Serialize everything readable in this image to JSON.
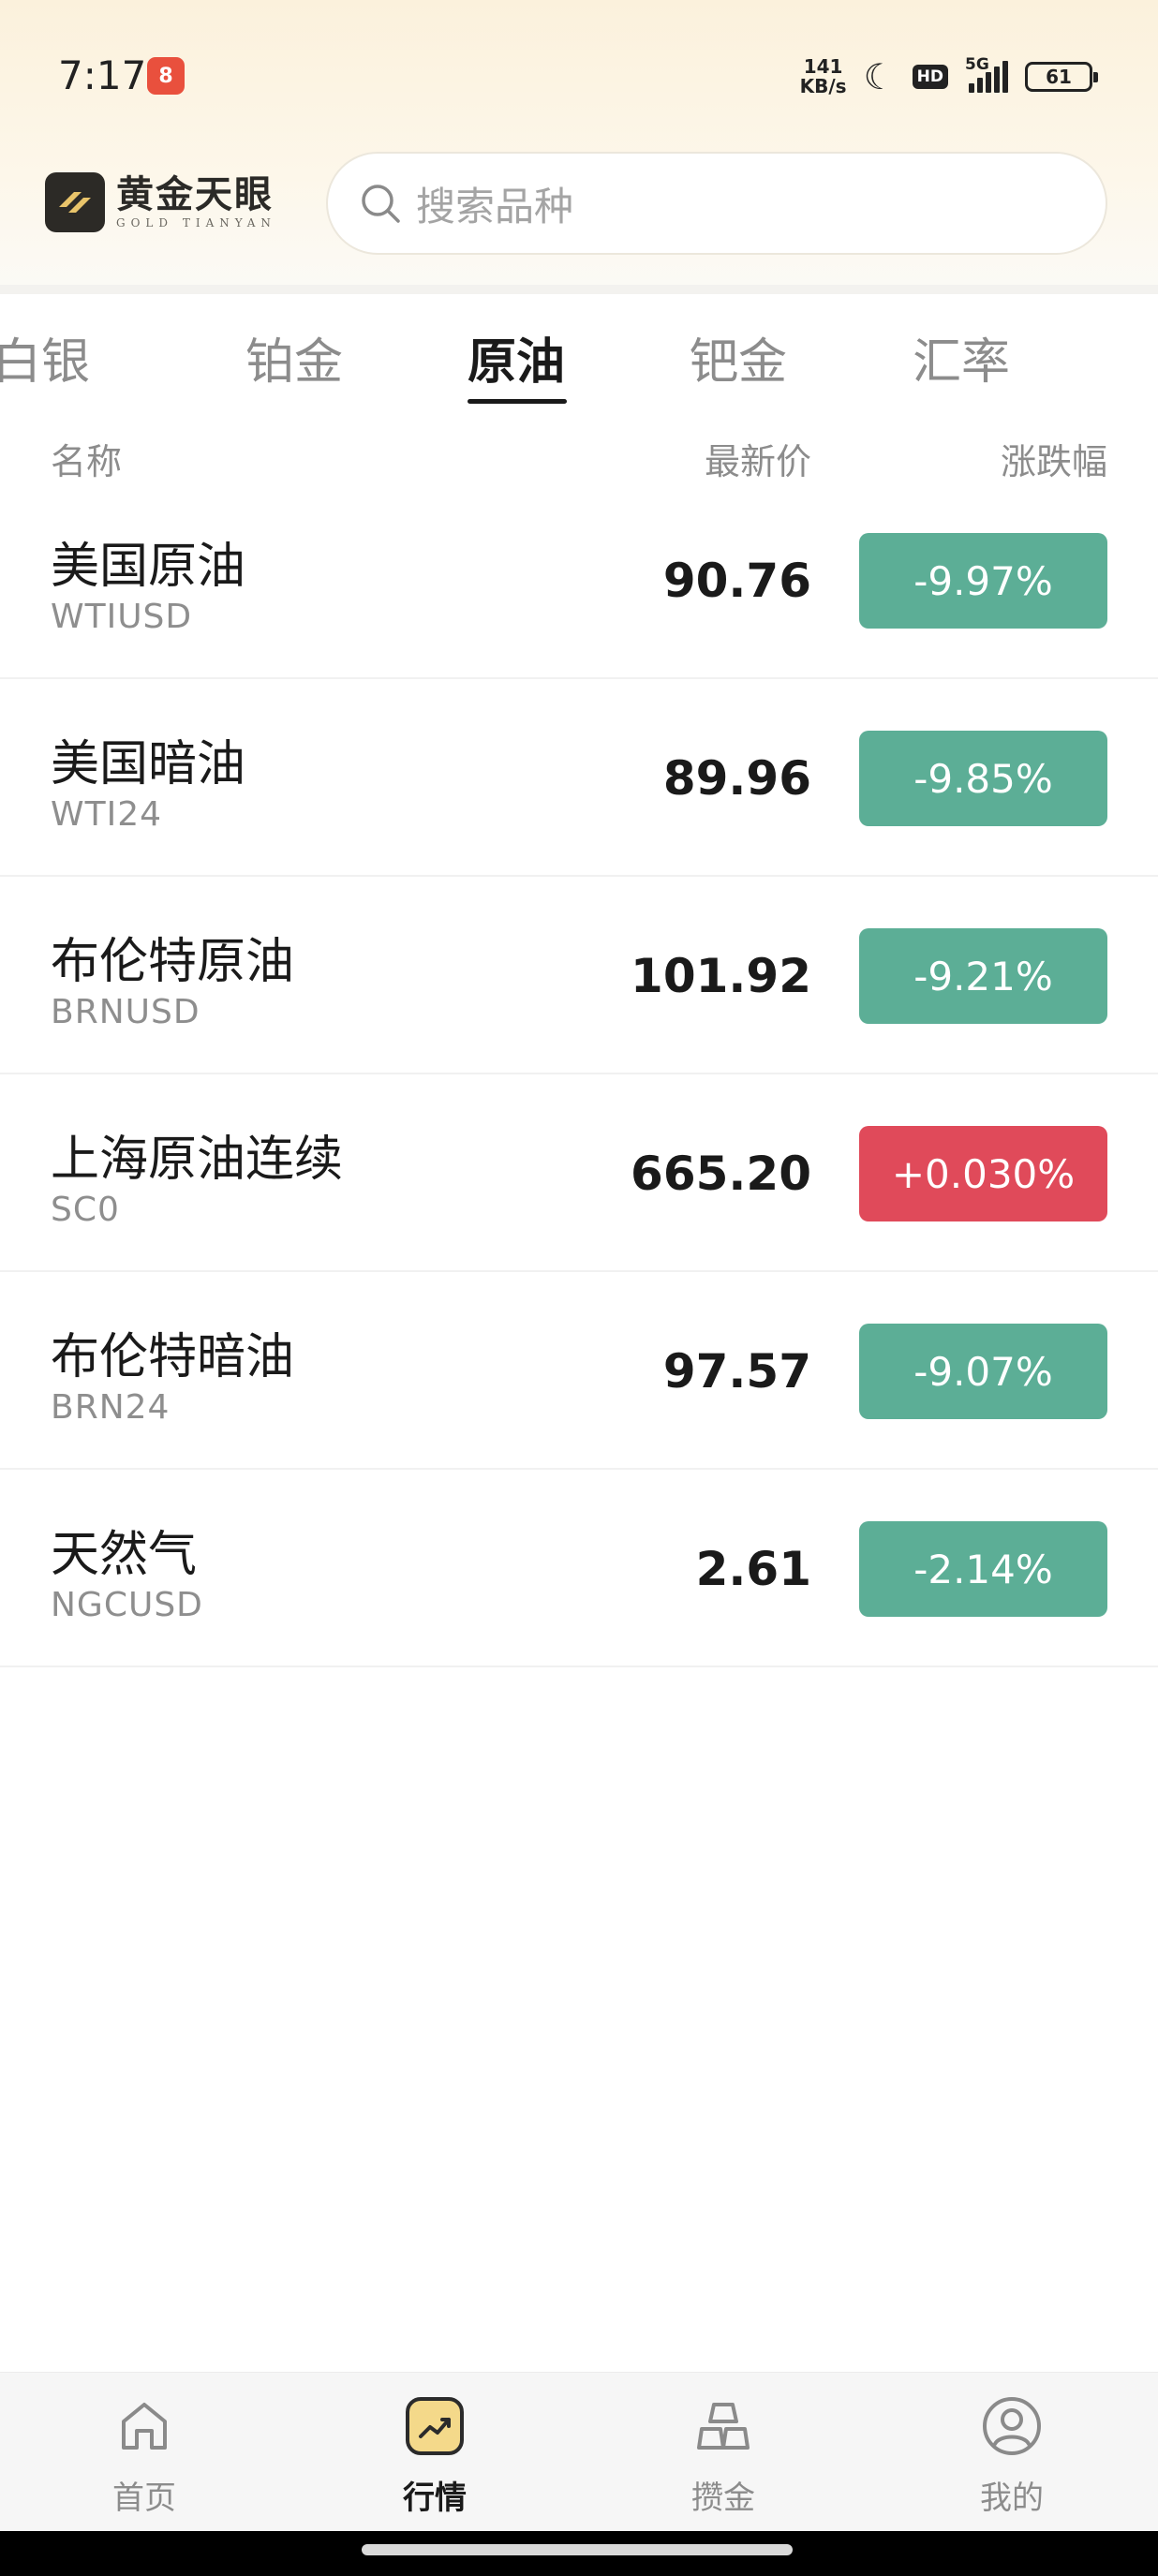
{
  "status_bar": {
    "time": "7:17",
    "app_badge": "8",
    "net_speed_value": "141",
    "net_speed_unit": "KB/s",
    "hd": "HD",
    "network": "5G",
    "battery": "61"
  },
  "header": {
    "logo_cn": "黄金天眼",
    "logo_en": "GOLD TIANYAN",
    "search_placeholder": "搜索品种"
  },
  "tabs": [
    {
      "label": "白银",
      "active": false
    },
    {
      "label": "铂金",
      "active": false
    },
    {
      "label": "原油",
      "active": true
    },
    {
      "label": "钯金",
      "active": false
    },
    {
      "label": "汇率",
      "active": false
    }
  ],
  "columns": {
    "name": "名称",
    "price": "最新价",
    "change": "涨跌幅"
  },
  "quotes": [
    {
      "name": "美国原油",
      "code": "WTIUSD",
      "price": "90.76",
      "change": "-9.97%",
      "direction": "down"
    },
    {
      "name": "美国暗油",
      "code": "WTI24",
      "price": "89.96",
      "change": "-9.85%",
      "direction": "down"
    },
    {
      "name": "布伦特原油",
      "code": "BRNUSD",
      "price": "101.92",
      "change": "-9.21%",
      "direction": "down"
    },
    {
      "name": "上海原油连续",
      "code": "SC0",
      "price": "665.20",
      "change": "+0.030%",
      "direction": "up"
    },
    {
      "name": "布伦特暗油",
      "code": "BRN24",
      "price": "97.57",
      "change": "-9.07%",
      "direction": "down"
    },
    {
      "name": "天然气",
      "code": "NGCUSD",
      "price": "2.61",
      "change": "-2.14%",
      "direction": "down"
    }
  ],
  "colors": {
    "down": "#5cae96",
    "up": "#e04a5a",
    "accent_gold": "#e9c46a"
  },
  "bottom_nav": [
    {
      "label": "首页",
      "icon": "home-icon",
      "active": false
    },
    {
      "label": "行情",
      "icon": "market-trend-icon",
      "active": true
    },
    {
      "label": "攒金",
      "icon": "gold-bars-icon",
      "active": false
    },
    {
      "label": "我的",
      "icon": "profile-icon",
      "active": false
    }
  ]
}
